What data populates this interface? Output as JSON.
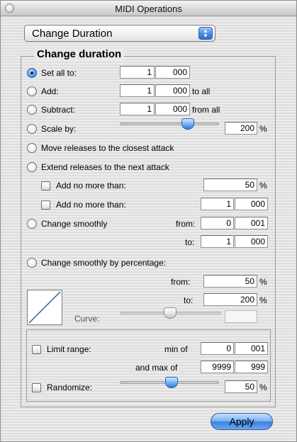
{
  "window": {
    "title": "MIDI Operations"
  },
  "popup": {
    "selected": "Change Duration"
  },
  "group": {
    "title": "Change duration"
  },
  "options": {
    "set_all_to": {
      "label": "Set all to:",
      "val1": "1",
      "val2": "000",
      "selected": true
    },
    "add": {
      "label": "Add:",
      "val1": "1",
      "val2": "000",
      "suffix": "to all"
    },
    "subtract": {
      "label": "Subtract:",
      "val1": "1",
      "val2": "000",
      "suffix": "from all"
    },
    "scale_by": {
      "label": "Scale by:",
      "value": "200",
      "unit": "%",
      "slider_value": 200
    },
    "move_releases": {
      "label": "Move releases to the closest attack"
    },
    "extend_releases": {
      "label": "Extend releases to the next attack"
    },
    "add_no_more_than_pct": {
      "label": "Add no more than:",
      "value": "50",
      "unit": "%"
    },
    "add_no_more_than_time": {
      "label": "Add no more than:",
      "val1": "1",
      "val2": "000"
    },
    "change_smoothly": {
      "label": "Change smoothly",
      "from_label": "from:",
      "from_val1": "0",
      "from_val2": "001",
      "to_label": "to:",
      "to_val1": "1",
      "to_val2": "000"
    },
    "change_smoothly_pct": {
      "label": "Change smoothly by percentage:",
      "from_label": "from:",
      "from_value": "50",
      "from_unit": "%",
      "to_label": "to:",
      "to_value": "200",
      "to_unit": "%",
      "curve_label": "Curve:",
      "curve_value": ""
    }
  },
  "limit_range": {
    "label": "Limit range:",
    "min_label": "min of",
    "min_val1": "0",
    "min_val2": "001",
    "max_label": "and max of",
    "max_val1": "9999",
    "max_val2": "999"
  },
  "randomize": {
    "label": "Randomize:",
    "value": "50",
    "unit": "%",
    "slider_value": 50
  },
  "apply_label": "Apply"
}
